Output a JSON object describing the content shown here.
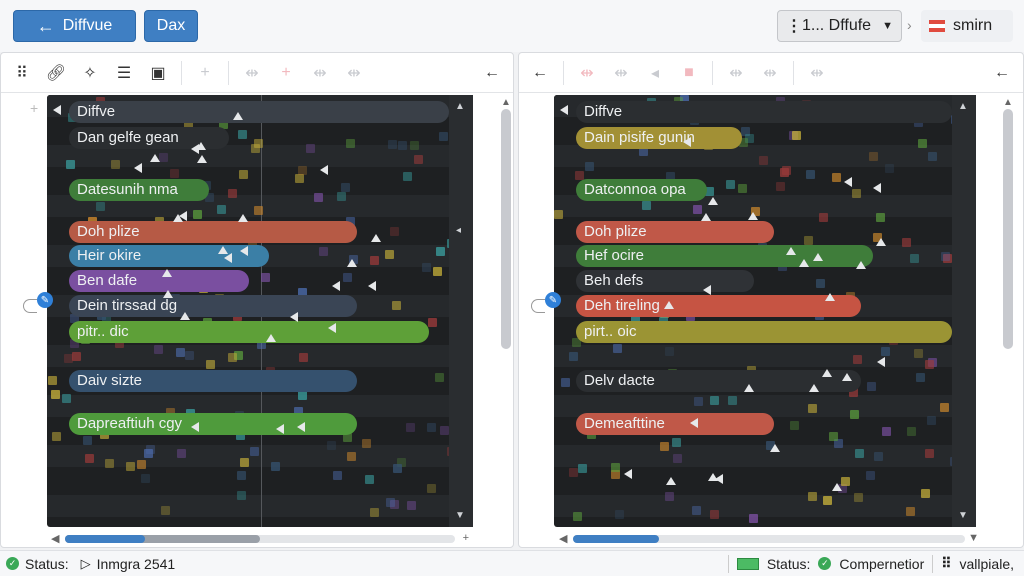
{
  "header": {
    "back_label": "Diffvue",
    "dax_label": "Dax",
    "select_value": "1... Dffufe",
    "user_label": "smirn"
  },
  "toolbar_icons": [
    "grid-icon",
    "link-icon",
    "puzzle-icon",
    "stack-icon",
    "image-icon"
  ],
  "left_pane": {
    "rows": [
      {
        "label": "Diffve",
        "color": "#3a4048",
        "width": 0.95
      },
      {
        "label": "Dan gelfe  gean",
        "color": "#2b2e31",
        "width": 0.4
      },
      {
        "label": "Datesunih  nma",
        "color": "#3f7d3a",
        "width": 0.35
      },
      {
        "label": "Doh plize",
        "color": "#b65a45",
        "width": 0.72
      },
      {
        "label": "Heir okire",
        "color": "#3b7fa6",
        "width": 0.5
      },
      {
        "label": "Ben dafe",
        "color": "#7a4fa0",
        "width": 0.45
      },
      {
        "label": "Dein tirssad dg",
        "color": "#3a4555",
        "width": 0.72
      },
      {
        "label": "pitr..  dic",
        "color": "#5ea038",
        "width": 0.9
      },
      {
        "label": "Daiv sizte",
        "color": "#35516e",
        "width": 0.72
      },
      {
        "label": "Dapreaftiuh cgy",
        "color": "#4f9b3c",
        "width": 0.72
      }
    ]
  },
  "right_pane": {
    "rows": [
      {
        "label": "Diffve",
        "color": "#2b2e31",
        "width": 0.95
      },
      {
        "label": "Dain pisife  gunin",
        "color": "#a29035",
        "width": 0.42
      },
      {
        "label": "Datconnoa  opa",
        "color": "#3f7d3a",
        "width": 0.33
      },
      {
        "label": "Doh plize",
        "color": "#c05848",
        "width": 0.5
      },
      {
        "label": "Hef ocire",
        "color": "#3f7d3a",
        "width": 0.75
      },
      {
        "label": "Beh defs",
        "color": "#2f3236",
        "width": 0.45
      },
      {
        "label": "Deh tireling",
        "color": "#c65443",
        "width": 0.72
      },
      {
        "label": "pirt..  oic",
        "color": "#9b9434",
        "width": 0.95
      },
      {
        "label": "Delv dacte",
        "color": "#2b2e31",
        "width": 0.72
      },
      {
        "label": "Demeafttine",
        "color": "#c05848",
        "width": 0.5
      }
    ]
  },
  "scroll": {
    "left_position": 0.5,
    "right_position": 0.22
  },
  "status": {
    "left_label": "Status:",
    "left_value": "Inmgra 2541",
    "right_label": "Status:",
    "right_mode": "Compernetior",
    "right_value": "vallpiale,"
  },
  "colors": {
    "accent": "#3f7fc3",
    "status_ok": "#3aa857"
  }
}
